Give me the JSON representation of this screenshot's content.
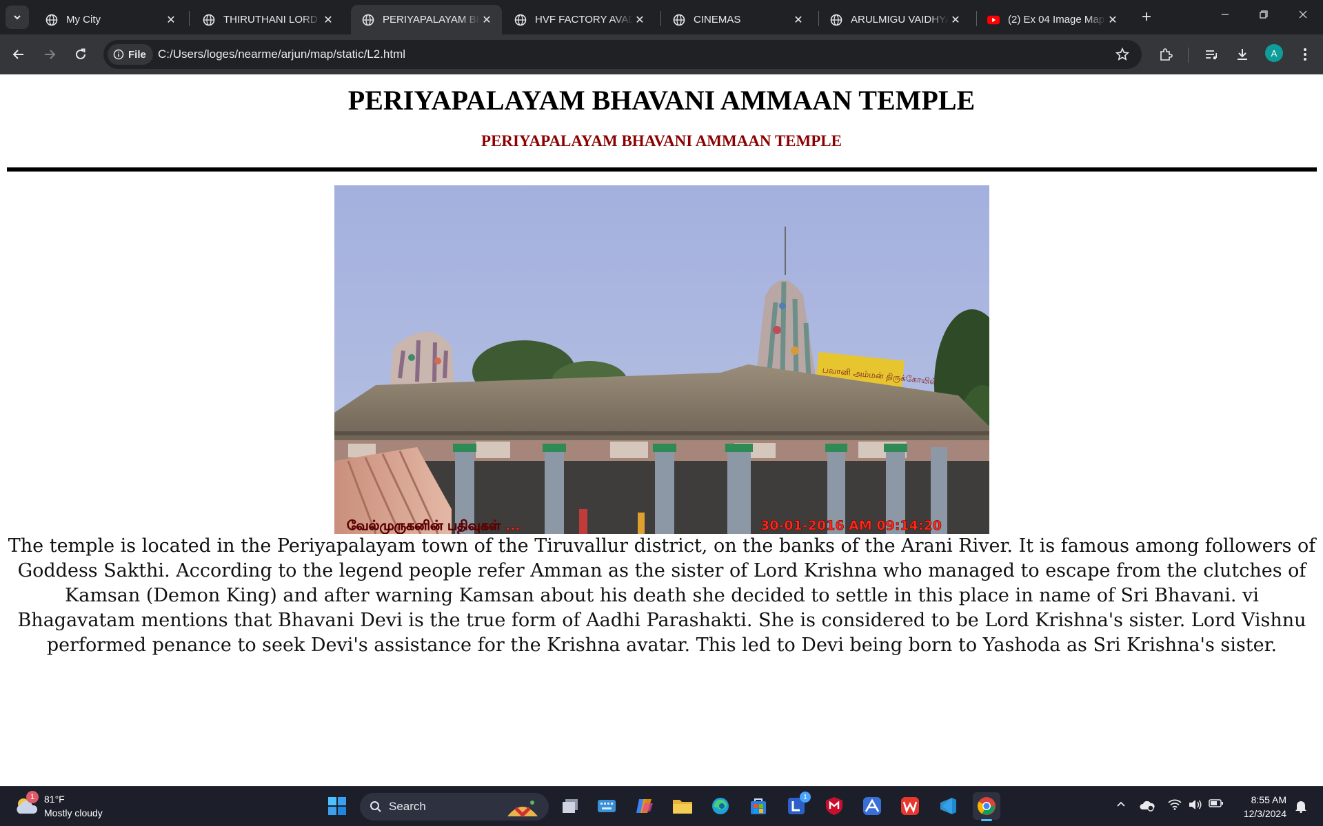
{
  "browser": {
    "tabs": [
      {
        "title": "My City",
        "favicon": "globe-icon",
        "active": false
      },
      {
        "title": "THIRUTHANI LORD M",
        "favicon": "globe-icon",
        "active": false
      },
      {
        "title": "PERIYAPALAYAM BHA",
        "favicon": "globe-icon",
        "active": true
      },
      {
        "title": "HVF FACTORY AVADI",
        "favicon": "globe-icon",
        "active": false
      },
      {
        "title": "CINEMAS",
        "favicon": "globe-icon",
        "active": false
      },
      {
        "title": "ARULMIGU VAIDHYA",
        "favicon": "globe-icon",
        "active": false
      },
      {
        "title": "(2) Ex 04 Image Map",
        "favicon": "youtube-icon",
        "active": false
      }
    ],
    "address": {
      "chip_label": "File",
      "url": "C:/Users/loges/nearme/arjun/map/static/L2.html"
    },
    "profile_initial": "A"
  },
  "page": {
    "title": "PERIYAPALAYAM BHAVANI AMMAAN TEMPLE",
    "subtitle": "PERIYAPALAYAM BHAVANI AMMAAN TEMPLE",
    "image": {
      "caption_left": "வேல்முருகனின் பதிவுகள் ...",
      "caption_right": "30-01-2016 AM 09:14:20",
      "sign_text": "பவானி அம்மன் திருக்கோயில்"
    },
    "paragraph": "The temple is located in the Periyapalayam town of the Tiruvallur district, on the banks of the Arani River. It is famous among followers of Goddess Sakthi. According to the legend people refer Amman as the sister of Lord Krishna who managed to escape from the clutches of Kamsan (Demon King) and after warning Kamsan about his death she decided to settle in this place in name of Sri Bhavani. vi Bhagavatam mentions that Bhavani Devi is the true form of Aadhi Parashakti. She is considered to be Lord Krishna's sister. Lord Vishnu performed penance to seek Devi's assistance for the Krishna avatar. This led to Devi being born to Yashoda as Sri Krishna's sister."
  },
  "taskbar": {
    "weather": {
      "temp": "81°F",
      "condition": "Mostly cloudy",
      "badge": "1"
    },
    "search_placeholder": "Search",
    "clock": {
      "time": "8:55 AM",
      "date": "12/3/2024"
    },
    "app_badge": "1",
    "colors": {
      "accent": "#1a73e8",
      "taskbar_bg": "#1c1f2a"
    }
  }
}
